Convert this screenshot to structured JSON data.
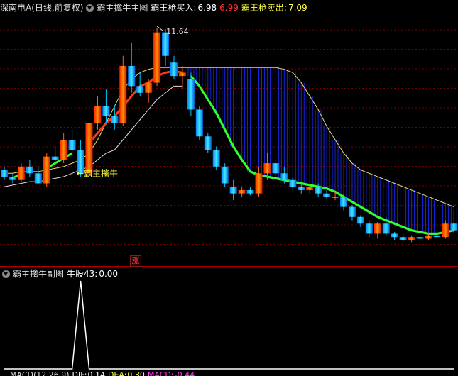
{
  "main_header": {
    "stock": "深南电A(日线,前复权)",
    "indicator": "霸主擒牛主图",
    "buy_label": "霸王枪买入:",
    "buy_value": "6.98",
    "mid_value": "6.99",
    "sell_label": "霸王枪卖出:",
    "sell_value": "7.09"
  },
  "annotations": {
    "peak_price": "11.64",
    "signal_label": "←霸主擒牛",
    "zhang_badge": "涨"
  },
  "sub_header": {
    "indicator": "霸主擒牛副图",
    "value_label": "牛股43:",
    "value": "0.00"
  },
  "macd_header": {
    "name": "MACD(12,26,9)",
    "dif_label": "DIF:",
    "dif": "0.14",
    "dea_label": "DEA:",
    "dea": "0.30",
    "macd_label": "MACD:",
    "macd": "-0.44"
  },
  "colors": {
    "up": "#ff3030",
    "down": "#00c8ff",
    "buy": "#ffffff",
    "sell": "#ffff40",
    "macd": "#ff40ff",
    "bull_line": "#30ff30",
    "grid": "#7a0000"
  },
  "chart_data": {
    "type": "candlestick",
    "ohlc": [
      [
        7.4,
        7.5,
        7.1,
        7.2
      ],
      [
        7.2,
        7.3,
        7.0,
        7.1
      ],
      [
        7.1,
        7.6,
        7.05,
        7.5
      ],
      [
        7.5,
        7.7,
        7.2,
        7.3
      ],
      [
        7.3,
        7.5,
        7.0,
        7.0
      ],
      [
        7.0,
        7.9,
        6.9,
        7.8
      ],
      [
        7.8,
        8.1,
        7.6,
        7.7
      ],
      [
        7.7,
        8.5,
        7.6,
        8.3
      ],
      [
        8.3,
        8.6,
        7.9,
        8.0
      ],
      [
        8.0,
        8.3,
        7.2,
        7.3
      ],
      [
        7.3,
        8.9,
        6.9,
        8.8
      ],
      [
        8.8,
        9.6,
        8.6,
        9.3
      ],
      [
        9.3,
        9.8,
        8.8,
        9.0
      ],
      [
        9.0,
        9.3,
        8.6,
        8.8
      ],
      [
        8.8,
        10.8,
        8.7,
        10.5
      ],
      [
        10.5,
        11.2,
        9.7,
        9.9
      ],
      [
        9.9,
        10.3,
        9.6,
        9.7
      ],
      [
        9.7,
        10.1,
        9.4,
        10.0
      ],
      [
        10.0,
        11.64,
        9.9,
        11.5
      ],
      [
        11.5,
        11.6,
        10.5,
        10.8
      ],
      [
        10.6,
        10.8,
        10.1,
        10.2
      ],
      [
        10.2,
        10.5,
        9.8,
        10.3
      ],
      [
        10.1,
        10.3,
        9.0,
        9.2
      ],
      [
        9.2,
        9.3,
        8.3,
        8.4
      ],
      [
        8.4,
        8.5,
        7.9,
        8.0
      ],
      [
        8.0,
        8.1,
        7.4,
        7.5
      ],
      [
        7.5,
        7.6,
        6.9,
        7.0
      ],
      [
        6.9,
        7.1,
        6.5,
        6.7
      ],
      [
        6.7,
        6.9,
        6.6,
        6.8
      ],
      [
        6.8,
        6.9,
        6.65,
        6.7
      ],
      [
        6.7,
        7.5,
        6.6,
        7.3
      ],
      [
        7.3,
        7.9,
        7.1,
        7.6
      ],
      [
        7.6,
        7.7,
        7.2,
        7.3
      ],
      [
        7.3,
        7.5,
        7.0,
        7.1
      ],
      [
        7.1,
        7.2,
        6.8,
        6.9
      ],
      [
        6.9,
        7.0,
        6.7,
        6.8
      ],
      [
        6.8,
        7.0,
        6.7,
        6.9
      ],
      [
        6.9,
        7.0,
        6.6,
        6.7
      ],
      [
        6.7,
        6.8,
        6.55,
        6.6
      ],
      [
        6.6,
        6.75,
        6.5,
        6.6
      ],
      [
        6.6,
        6.7,
        6.2,
        6.3
      ],
      [
        6.3,
        6.35,
        5.9,
        6.0
      ],
      [
        6.0,
        6.05,
        5.7,
        5.8
      ],
      [
        5.8,
        5.9,
        5.4,
        5.5
      ],
      [
        5.5,
        5.85,
        5.35,
        5.8
      ],
      [
        5.8,
        6.0,
        5.45,
        5.5
      ],
      [
        5.5,
        5.55,
        5.3,
        5.4
      ],
      [
        5.4,
        5.5,
        5.25,
        5.3
      ],
      [
        5.3,
        5.45,
        5.25,
        5.4
      ],
      [
        5.4,
        5.5,
        5.3,
        5.35
      ],
      [
        5.35,
        5.5,
        5.3,
        5.45
      ],
      [
        5.45,
        5.6,
        5.35,
        5.4
      ],
      [
        5.4,
        5.9,
        5.35,
        5.8
      ],
      [
        5.8,
        6.2,
        5.5,
        5.6
      ]
    ],
    "bull_line_segments": [
      [
        1,
        2
      ],
      [
        5,
        8
      ],
      [
        10,
        21
      ],
      [
        24,
        53
      ]
    ],
    "bull_values": [
      7.2,
      7.15,
      7.3,
      7.35,
      7.4,
      7.45,
      7.6,
      7.75,
      7.9,
      8.0,
      8.2,
      8.5,
      8.8,
      9.0,
      9.3,
      9.6,
      9.9,
      10.0,
      10.2,
      10.3,
      10.35,
      10.3,
      10.2,
      9.9,
      9.5,
      9.1,
      8.6,
      8.1,
      7.7,
      7.35,
      7.25,
      7.2,
      7.15,
      7.1,
      7.05,
      7.0,
      6.95,
      6.9,
      6.85,
      6.75,
      6.6,
      6.45,
      6.3,
      6.15,
      6.0,
      5.9,
      5.8,
      5.7,
      5.6,
      5.55,
      5.5,
      5.5,
      5.55,
      5.6
    ],
    "upper_band": [
      7.3,
      7.3,
      7.35,
      7.35,
      7.35,
      7.4,
      7.45,
      7.5,
      7.6,
      7.7,
      7.9,
      8.3,
      8.8,
      9.3,
      9.8,
      10.1,
      10.3,
      10.4,
      10.45,
      10.45,
      10.45,
      10.45,
      10.45,
      10.45,
      10.45,
      10.45,
      10.45,
      10.45,
      10.45,
      10.45,
      10.45,
      10.45,
      10.45,
      10.4,
      10.3,
      10.0,
      9.6,
      9.2,
      8.7,
      8.3,
      7.9,
      7.6,
      7.4,
      7.3,
      7.2,
      7.1,
      7.0,
      6.9,
      6.8,
      6.7,
      6.6,
      6.5,
      6.4,
      6.3
    ],
    "lower_band": [
      6.9,
      6.95,
      7.0,
      7.05,
      7.05,
      7.1,
      7.15,
      7.2,
      7.3,
      7.4,
      7.5,
      7.7,
      7.9,
      8.0,
      8.3,
      8.6,
      8.9,
      9.2,
      9.5,
      9.7,
      9.9,
      9.9
    ],
    "price_range": [
      4.6,
      12.0
    ],
    "sub_values": [
      0,
      0,
      0,
      0,
      0,
      0,
      0,
      0,
      0,
      1,
      0,
      0,
      0,
      0,
      0,
      0,
      0,
      0,
      0,
      0,
      0,
      0,
      0,
      0,
      0,
      0,
      0,
      0,
      0,
      0,
      0,
      0,
      0,
      0,
      0,
      0,
      0,
      0,
      0,
      0,
      0,
      0,
      0,
      0,
      0,
      0,
      0,
      0,
      0,
      0,
      0,
      0,
      0,
      0
    ]
  }
}
